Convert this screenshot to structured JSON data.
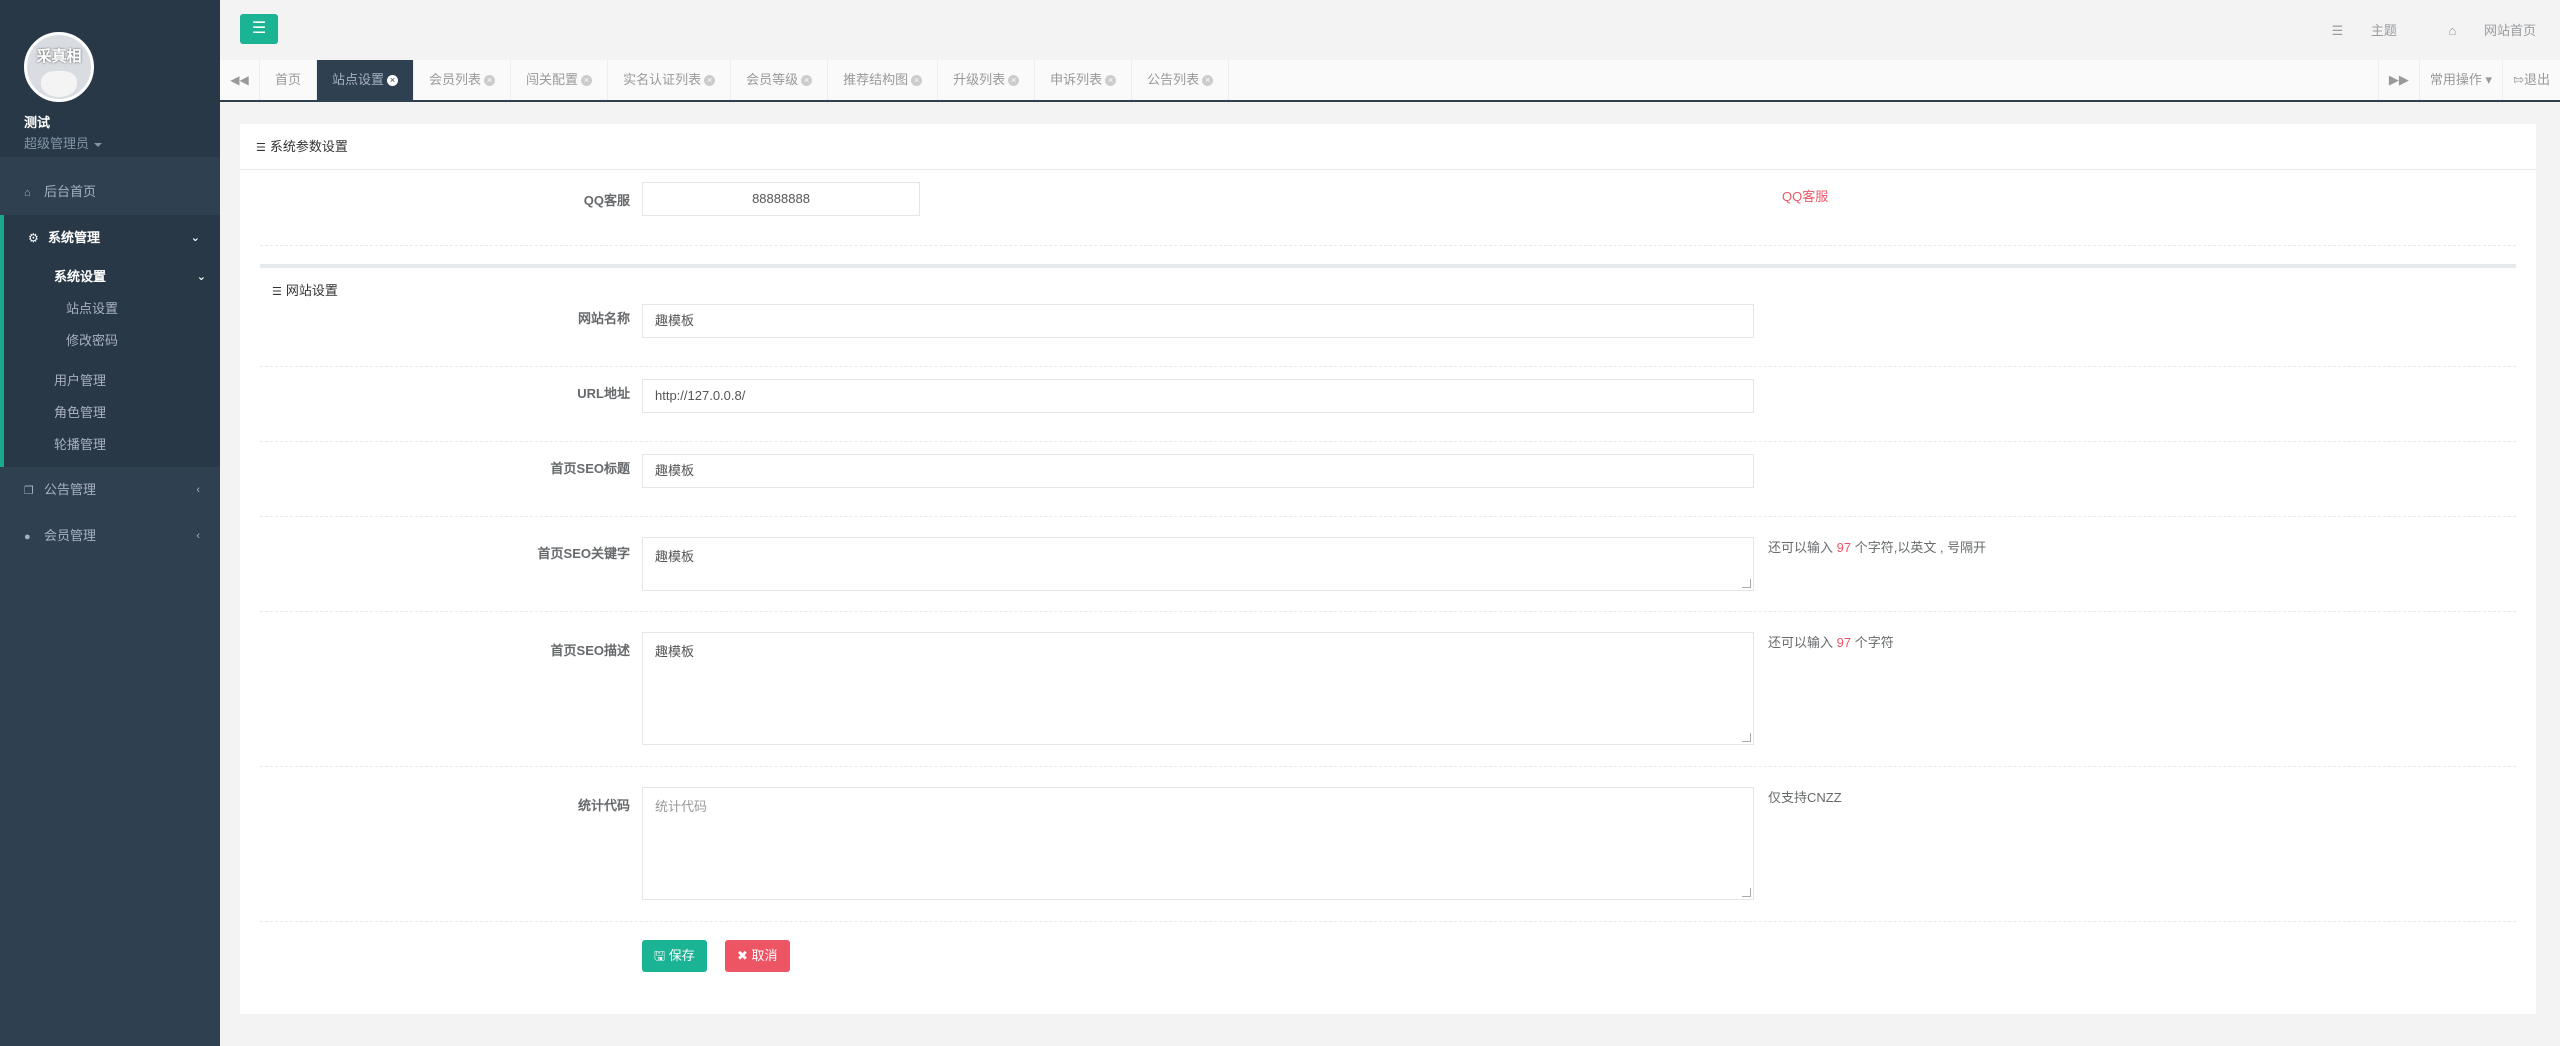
{
  "profile": {
    "avatar_text": "采真相",
    "username": "测试",
    "role": "超级管理员"
  },
  "sidebar": {
    "home": "后台首页",
    "system": "系统管理",
    "settings": "系统设置",
    "site_settings": "站点设置",
    "change_password": "修改密码",
    "user_mgmt": "用户管理",
    "role_mgmt": "角色管理",
    "carousel_mgmt": "轮播管理",
    "notice_mgmt": "公告管理",
    "member_mgmt": "会员管理"
  },
  "topbar": {
    "theme": "主题",
    "site_home": "网站首页"
  },
  "tabs": [
    "首页",
    "站点设置",
    "会员列表",
    "闯关配置",
    "实名认证列表",
    "会员等级",
    "推荐结构图",
    "升级列表",
    "申诉列表",
    "公告列表"
  ],
  "tab_right": {
    "common_ops": "常用操作",
    "logout": "退出"
  },
  "form": {
    "panel_title": "系统参数设置",
    "qq_label": "QQ客服",
    "qq_value": "88888888",
    "qq_help": "QQ客服",
    "section_title": "网站设置",
    "site_name_label": "网站名称",
    "site_name_value": "趣模板",
    "url_label": "URL地址",
    "url_value": "http://127.0.0.8/",
    "seo_title_label": "首页SEO标题",
    "seo_title_value": "趣模板",
    "seo_kw_label": "首页SEO关键字",
    "seo_kw_value": "趣模板",
    "seo_kw_help_pre": "还可以输入",
    "seo_kw_help_num": "97",
    "seo_kw_help_post": "个字符,以英文 , 号隔开",
    "seo_desc_label": "首页SEO描述",
    "seo_desc_value": "趣模板",
    "seo_desc_help_pre": "还可以输入",
    "seo_desc_help_num": "97",
    "seo_desc_help_post": "个字符",
    "stat_label": "统计代码",
    "stat_placeholder": "统计代码",
    "stat_help": "仅支持CNZZ",
    "save": "保存",
    "cancel": "取消"
  },
  "colors": {
    "sidebar_bg": "#2f4050",
    "accent": "#1ab394",
    "danger": "#ed5565"
  }
}
